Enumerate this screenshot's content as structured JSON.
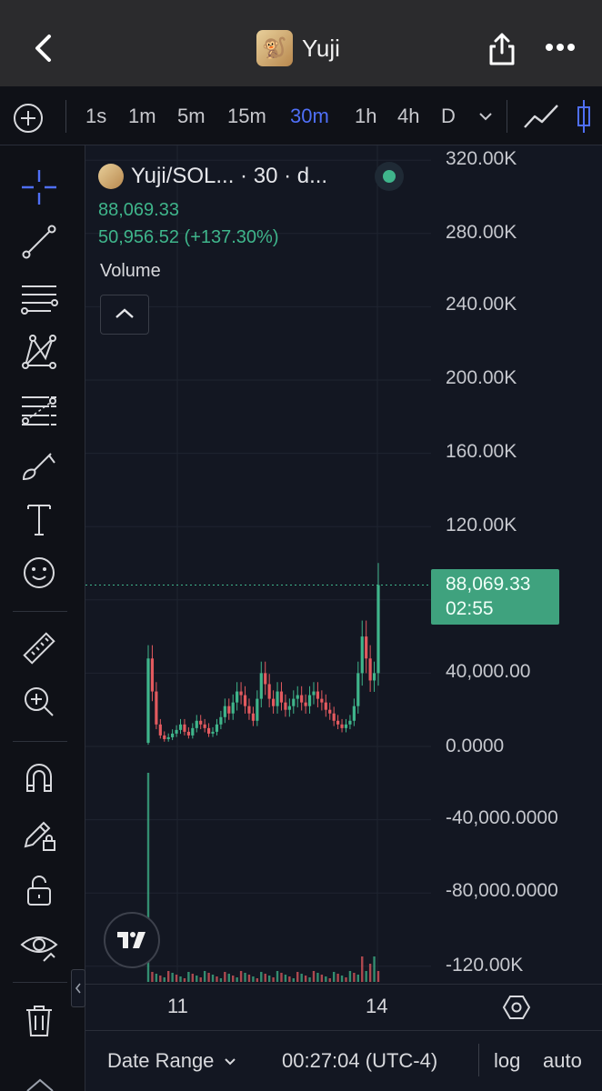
{
  "header": {
    "title": "Yuji",
    "back_icon": "chevron-left-icon",
    "share_icon": "share-icon",
    "more_icon": "more-horizontal-icon"
  },
  "toolbar": {
    "intervals": [
      "1s",
      "1m",
      "5m",
      "15m",
      "30m",
      "1h",
      "4h",
      "D"
    ],
    "active_interval": "30m"
  },
  "legend": {
    "symbol": "Yuji/SOL... · 30 · d...",
    "value1": "88,069.33",
    "value2": "50,956.52 (+137.30%)",
    "volume_label": "Volume"
  },
  "price_axis": {
    "labels": [
      "320.00K",
      "280.00K",
      "240.00K",
      "200.00K",
      "160.00K",
      "120.00K",
      "40,000.00",
      "0.0000",
      "-40,000.0000",
      "-80,000.0000",
      "-120.00K"
    ]
  },
  "price_tag": {
    "price": "88,069.33",
    "countdown": "02:55"
  },
  "time_axis": {
    "labels": [
      "11",
      "14"
    ]
  },
  "bottom_bar": {
    "date_range": "Date Range",
    "clock": "00:27:04 (UTC-4)",
    "log": "log",
    "auto": "auto"
  },
  "colors": {
    "up": "#3fb58b",
    "down": "#e35a5f",
    "accent": "#4f6ff7",
    "header_bg": "#2b2b2d",
    "chart_bg": "#131722"
  },
  "chart_data": {
    "type": "candlestick",
    "ylim": [
      -120000,
      320000
    ],
    "last_price": 88069.33,
    "x_ticks": [
      "11",
      "14"
    ],
    "approx_close_series": [
      48000,
      30000,
      12000,
      6000,
      4000,
      5000,
      7000,
      9000,
      12000,
      8000,
      6000,
      10000,
      14000,
      12000,
      10000,
      7000,
      8000,
      12000,
      16000,
      22000,
      18000,
      24000,
      30000,
      28000,
      22000,
      18000,
      14000,
      26000,
      40000,
      34000,
      26000,
      22000,
      30000,
      24000,
      20000,
      22000,
      26000,
      28000,
      24000,
      22000,
      28000,
      30000,
      26000,
      24000,
      20000,
      18000,
      14000,
      12000,
      10000,
      12000,
      14000,
      22000,
      40000,
      60000,
      48000,
      36000,
      40000,
      88069
    ],
    "volume_note": "volume bars along bottom; large spikes near day 11 start and near last candles"
  }
}
